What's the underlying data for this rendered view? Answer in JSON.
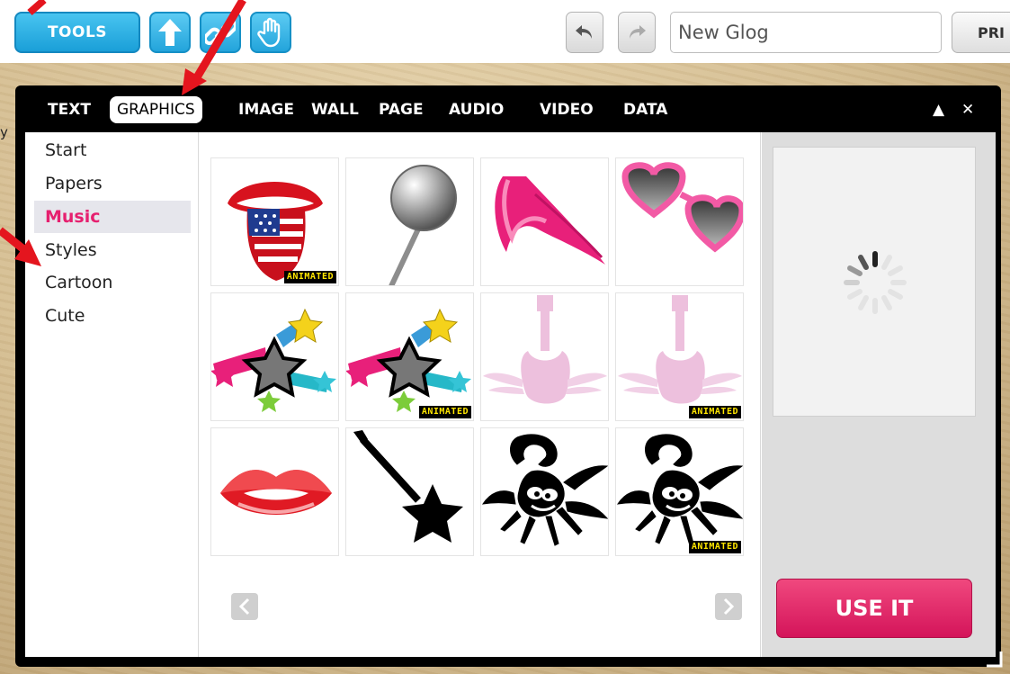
{
  "toolbar": {
    "tools_label": "TOOLS",
    "title_value": "New Glog",
    "pri_label": "PRI"
  },
  "dialog": {
    "tabs": [
      {
        "label": "TEXT",
        "active": false
      },
      {
        "label": "GRAPHICS",
        "active": true
      },
      {
        "label": "IMAGE",
        "active": false
      },
      {
        "label": "WALL",
        "active": false
      },
      {
        "label": "PAGE",
        "active": false
      },
      {
        "label": "AUDIO",
        "active": false
      },
      {
        "label": "VIDEO",
        "active": false
      },
      {
        "label": "DATA",
        "active": false
      }
    ],
    "collapse_glyph": "▲",
    "close_glyph": "✕"
  },
  "sidebar": {
    "categories": [
      "Start",
      "Papers",
      "Music",
      "Styles",
      "Cartoon",
      "Cute"
    ],
    "active": "Music"
  },
  "grid": {
    "badge_label": "ANIMATED",
    "items": [
      {
        "icon": "tongue-flag-icon",
        "animated": true
      },
      {
        "icon": "pushpin-icon",
        "animated": false
      },
      {
        "icon": "pink-hair-icon",
        "animated": false
      },
      {
        "icon": "heart-sunglasses-icon",
        "animated": false
      },
      {
        "icon": "shooting-stars-icon",
        "animated": false
      },
      {
        "icon": "shooting-stars-icon",
        "animated": true
      },
      {
        "icon": "winged-guitar-icon",
        "animated": false
      },
      {
        "icon": "winged-guitar-icon",
        "animated": true
      },
      {
        "icon": "red-lips-icon",
        "animated": false
      },
      {
        "icon": "star-guitar-icon",
        "animated": false
      },
      {
        "icon": "scorpion-icon",
        "animated": false
      },
      {
        "icon": "scorpion-icon",
        "animated": true
      }
    ]
  },
  "preview": {
    "use_it_label": "USE IT"
  },
  "edge_fragment": "y",
  "colors": {
    "accent_blue": "#1a9fd8",
    "accent_pink": "#e6206f",
    "badge_yellow": "#ffe600",
    "annotation_red": "#e4151e"
  }
}
